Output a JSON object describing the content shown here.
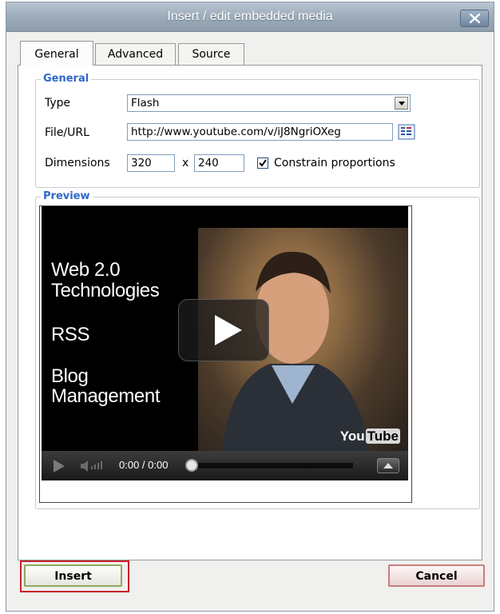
{
  "dialog": {
    "title": "Insert / edit embedded media",
    "close_label": "X"
  },
  "tabs": [
    {
      "label": "General",
      "active": true
    },
    {
      "label": "Advanced",
      "active": false
    },
    {
      "label": "Source",
      "active": false
    }
  ],
  "general": {
    "legend": "General",
    "type_label": "Type",
    "type_value": "Flash",
    "file_label": "File/URL",
    "file_value": "http://www.youtube.com/v/iJ8NgriOXeg",
    "dimensions_label": "Dimensions",
    "width_value": "320",
    "times_sign": "x",
    "height_value": "240",
    "constrain_label": "Constrain proportions",
    "constrain_checked": true
  },
  "preview": {
    "legend": "Preview",
    "video_lines": [
      "Web 2.0",
      "Technologies",
      "RSS",
      "Blog",
      "Management"
    ],
    "logo_you": "You",
    "logo_tube": "Tube",
    "time_display": "0:00 / 0:00"
  },
  "buttons": {
    "insert_label": "Insert",
    "cancel_label": "Cancel"
  },
  "colors": {
    "legend_blue": "#2d68c8",
    "highlight_red": "#c8202a",
    "insert_border": "#8eaa5c",
    "cancel_border": "#c77c7c"
  }
}
